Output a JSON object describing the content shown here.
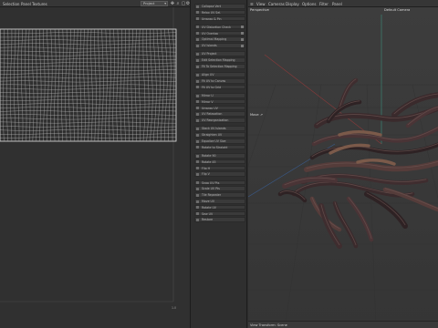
{
  "uv_editor": {
    "menu": [
      "Selection",
      "Panel",
      "Textures"
    ],
    "dropdown": "Project",
    "corner_label": "1.0",
    "toolbar_icons": [
      "move-icon",
      "zoom-icon",
      "fit-icon",
      "settings-icon"
    ]
  },
  "tool_list": {
    "items": [
      {
        "label": "Collapse Vert"
      },
      {
        "label": "Relax UV Sel."
      },
      {
        "label": "Unwrap & Pin"
      },
      {
        "label": "UV Distortion Check",
        "badge": true
      },
      {
        "label": "UV Overlap",
        "badge": true
      },
      {
        "label": "Optimal Mapping",
        "badge": true
      },
      {
        "label": "UV Islands",
        "badge": true
      },
      {
        "label": "UV Project"
      },
      {
        "label": "Edit Selection Mapping"
      },
      {
        "label": "Fit To Selection Mapping"
      },
      {
        "label": "Align UV"
      },
      {
        "label": "Fit UV to Canvas"
      },
      {
        "label": "Fit UV to Grid"
      },
      {
        "label": "Mirror U"
      },
      {
        "label": "Mirror V"
      },
      {
        "label": "Unwrap UV"
      },
      {
        "label": "UV Relaxation"
      },
      {
        "label": "UV Reorganization"
      },
      {
        "label": "Stack UV Islands"
      },
      {
        "label": "Straighten UV"
      },
      {
        "label": "Equalize UV Size"
      },
      {
        "label": "Rotate to Straight"
      },
      {
        "label": "Rotate 90"
      },
      {
        "label": "Rotate 45"
      },
      {
        "label": "Flip H"
      },
      {
        "label": "Flip V"
      },
      {
        "label": "Snap UV Pts"
      },
      {
        "label": "Scale UV Pts"
      },
      {
        "label": "Tile Repeater"
      },
      {
        "label": "Move UV"
      },
      {
        "label": "Rotate UV"
      },
      {
        "label": "Sew UV"
      },
      {
        "label": "Restore"
      }
    ]
  },
  "viewport": {
    "menu": [
      "View",
      "Cameras",
      "Display",
      "Options",
      "Filter",
      "Panel"
    ],
    "camera_label": "Perspective",
    "default_camera": "Default Camera",
    "move_label": "Move",
    "footer": "View Transform: Scene"
  }
}
